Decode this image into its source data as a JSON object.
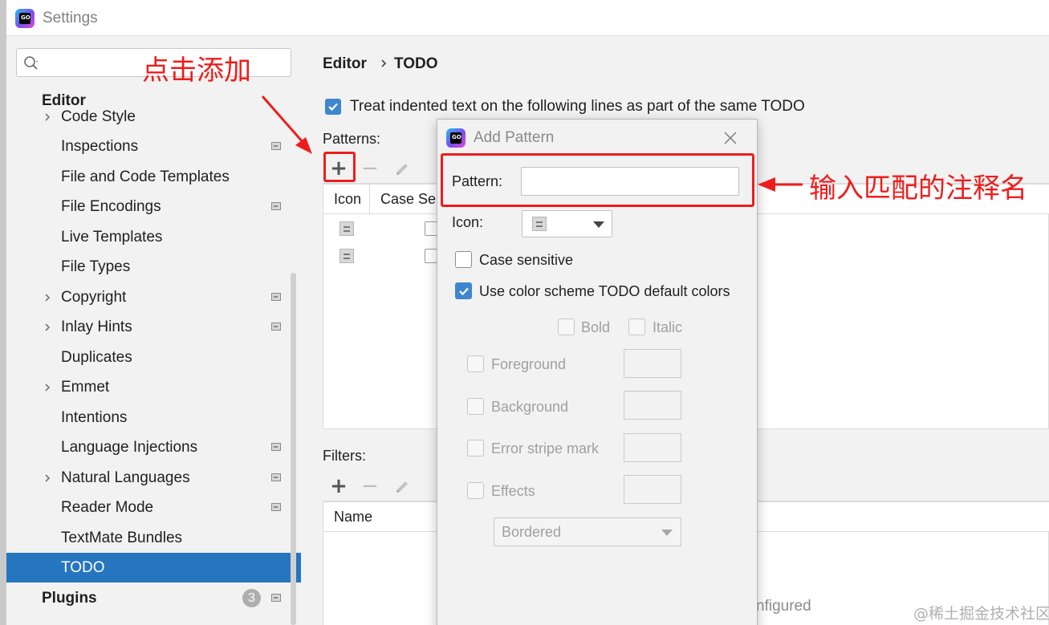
{
  "window": {
    "title": "Settings"
  },
  "sidebar": {
    "search": {
      "value": "",
      "placeholder": ""
    },
    "section_editor": "Editor",
    "items": [
      {
        "label": "Code Style",
        "expandable": true,
        "pinned": false
      },
      {
        "label": "Inspections",
        "expandable": false,
        "pinned": true
      },
      {
        "label": "File and Code Templates",
        "expandable": false,
        "pinned": false
      },
      {
        "label": "File Encodings",
        "expandable": false,
        "pinned": true
      },
      {
        "label": "Live Templates",
        "expandable": false,
        "pinned": false
      },
      {
        "label": "File Types",
        "expandable": false,
        "pinned": false
      },
      {
        "label": "Copyright",
        "expandable": true,
        "pinned": true
      },
      {
        "label": "Inlay Hints",
        "expandable": true,
        "pinned": true
      },
      {
        "label": "Duplicates",
        "expandable": false,
        "pinned": false
      },
      {
        "label": "Emmet",
        "expandable": true,
        "pinned": false
      },
      {
        "label": "Intentions",
        "expandable": false,
        "pinned": false
      },
      {
        "label": "Language Injections",
        "expandable": false,
        "pinned": true
      },
      {
        "label": "Natural Languages",
        "expandable": true,
        "pinned": true
      },
      {
        "label": "Reader Mode",
        "expandable": false,
        "pinned": true
      },
      {
        "label": "TextMate Bundles",
        "expandable": false,
        "pinned": false
      },
      {
        "label": "TODO",
        "expandable": false,
        "pinned": false,
        "selected": true
      }
    ],
    "section_plugins": "Plugins",
    "plugins_badge": "3"
  },
  "annotations": {
    "click_add": "点击添加",
    "enter_name": "输入匹配的注释名",
    "color": "#ee1d1d"
  },
  "main": {
    "breadcrumb": [
      "Editor",
      "TODO"
    ],
    "treat_indented_label": "Treat indented text on the following lines as part of the same TODO",
    "treat_indented_checked": true,
    "patterns_label": "Patterns:",
    "patterns_columns": [
      "Icon",
      "Case Sen"
    ],
    "filters_label": "Filters:",
    "filters_columns": [
      "Name"
    ],
    "footer_text": "nfigured"
  },
  "dialog": {
    "title": "Add Pattern",
    "pattern_label": "Pattern:",
    "pattern_value": "",
    "icon_label": "Icon:",
    "case_sensitive_label": "Case sensitive",
    "case_sensitive_checked": false,
    "use_colors_label": "Use color scheme TODO default colors",
    "use_colors_checked": true,
    "bold_label": "Bold",
    "italic_label": "Italic",
    "foreground_label": "Foreground",
    "background_label": "Background",
    "error_stripe_label": "Error stripe mark",
    "effects_label": "Effects",
    "effect_type": "Bordered"
  },
  "watermark": "@稀土掘金技术社区",
  "colors": {
    "accent": "#2675bf",
    "checkbox": "#3e87cf",
    "annotation": "#ee1d1d"
  }
}
